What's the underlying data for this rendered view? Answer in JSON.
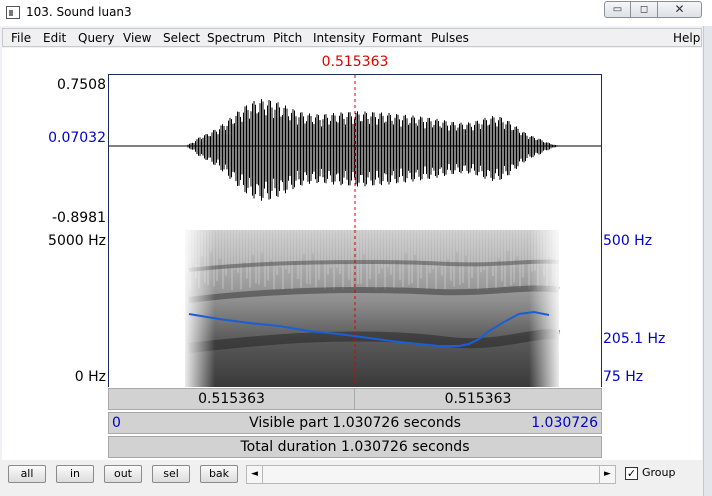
{
  "window": {
    "title": "103. Sound luan3",
    "minimize_glyph": "▭",
    "maximize_glyph": "◻",
    "close_glyph": "✕"
  },
  "menu": [
    "File",
    "Edit",
    "Query",
    "View",
    "Select",
    "Spectrum",
    "Pitch",
    "Intensity",
    "Formant",
    "Pulses",
    "Help"
  ],
  "cursor_time": "0.515363",
  "waveform": {
    "max_label": "0.7508",
    "cursor_value_label": "0.07032",
    "min_label": "-0.8981"
  },
  "spectrogram": {
    "freq_top_label": "5000 Hz",
    "freq_bottom_label": "0 Hz",
    "pitch_top_label": "500 Hz",
    "pitch_value_label": "205.1 Hz",
    "pitch_bottom_label": "75 Hz"
  },
  "time_bars": {
    "left_segment": "0.515363",
    "right_segment": "0.515363",
    "visible_start": "0",
    "visible_text": "Visible part 1.030726 seconds",
    "visible_end": "1.030726",
    "total_text": "Total duration 1.030726 seconds"
  },
  "buttons": {
    "all": "all",
    "in": "in",
    "out": "out",
    "sel": "sel",
    "bak": "bak"
  },
  "scrollbar": {
    "left_arrow": "◄",
    "right_arrow": "►"
  },
  "group": {
    "label": "Group",
    "checked": true,
    "check_glyph": "✓"
  },
  "colors": {
    "cursor": "#e00000",
    "axis_blue": "#0000cc",
    "pitch_curve": "#1a5fd6"
  }
}
